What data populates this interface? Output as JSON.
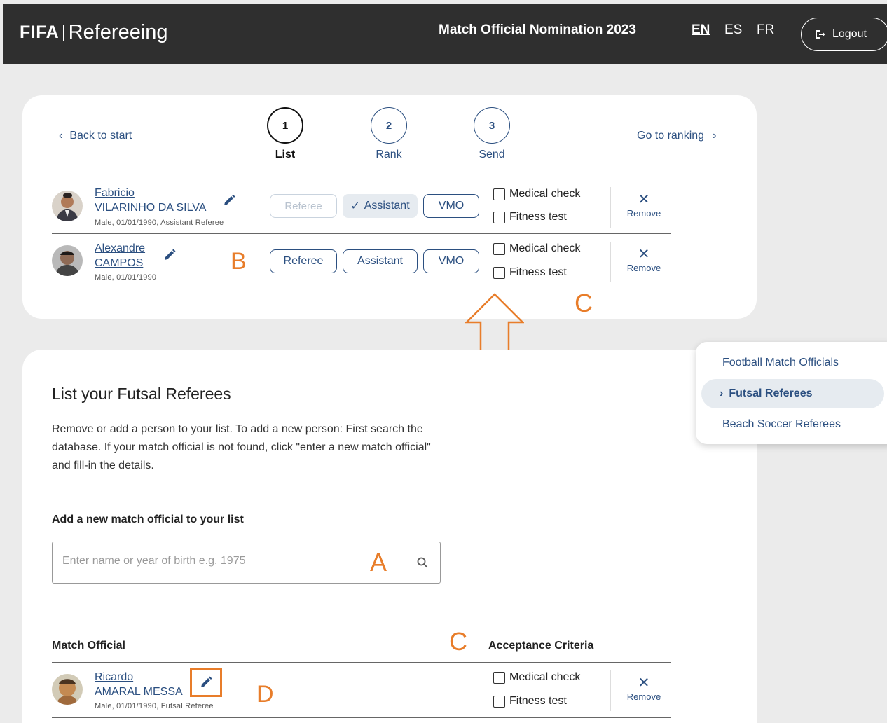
{
  "header": {
    "brand": "FIFA",
    "product": "Refereeing",
    "title": "Match Official Nomination 2023",
    "languages": [
      "EN",
      "ES",
      "FR"
    ],
    "active_language": "EN",
    "logout_label": "Logout"
  },
  "stepper": {
    "back_label": "Back to start",
    "forward_label": "Go to ranking",
    "steps": [
      {
        "number": "1",
        "label": "List"
      },
      {
        "number": "2",
        "label": "Rank"
      },
      {
        "number": "3",
        "label": "Send"
      }
    ]
  },
  "nominees": [
    {
      "first_name": "Fabricio",
      "last_name": "VILARINHO DA SILVA",
      "info": "Male, 01/01/1990, Assistant Referee",
      "roles": [
        "Referee",
        "Assistant",
        "VMO"
      ],
      "selected_role": "Assistant",
      "checks": [
        "Medical check",
        "Fitness test"
      ],
      "remove_label": "Remove"
    },
    {
      "first_name": "Alexandre",
      "last_name": "CAMPOS",
      "info": "Male, 01/01/1990",
      "roles": [
        "Referee",
        "Assistant",
        "VMO"
      ],
      "checks": [
        "Medical check",
        "Fitness test"
      ],
      "remove_label": "Remove"
    }
  ],
  "annotations": {
    "a": "A",
    "b": "B",
    "c": "C",
    "d": "D"
  },
  "list_section": {
    "title": "List your Futsal Referees",
    "description": "Remove or add a person to your list. To add a new person: First search the database. If your match official is not found, click \"enter a new match official\" and fill-in the details.",
    "add_label": "Add a new match official to your list",
    "search_placeholder": "Enter name or year of birth e.g. 1975",
    "col_official": "Match Official",
    "col_criteria": "Acceptance Criteria",
    "rows": [
      {
        "first_name": "Ricardo",
        "last_name": "AMARAL MESSA",
        "info": "Male, 01/01/1990, Futsal Referee",
        "checks": [
          "Medical check",
          "Fitness test"
        ],
        "remove_label": "Remove"
      }
    ]
  },
  "side_nav": {
    "items": [
      "Football Match Officials",
      "Futsal Referees",
      "Beach Soccer Referees"
    ],
    "active": "Futsal Referees"
  },
  "colors": {
    "primary": "#2b4f80",
    "header_bg": "#2f2f2f",
    "annotation": "#e87d2a"
  }
}
